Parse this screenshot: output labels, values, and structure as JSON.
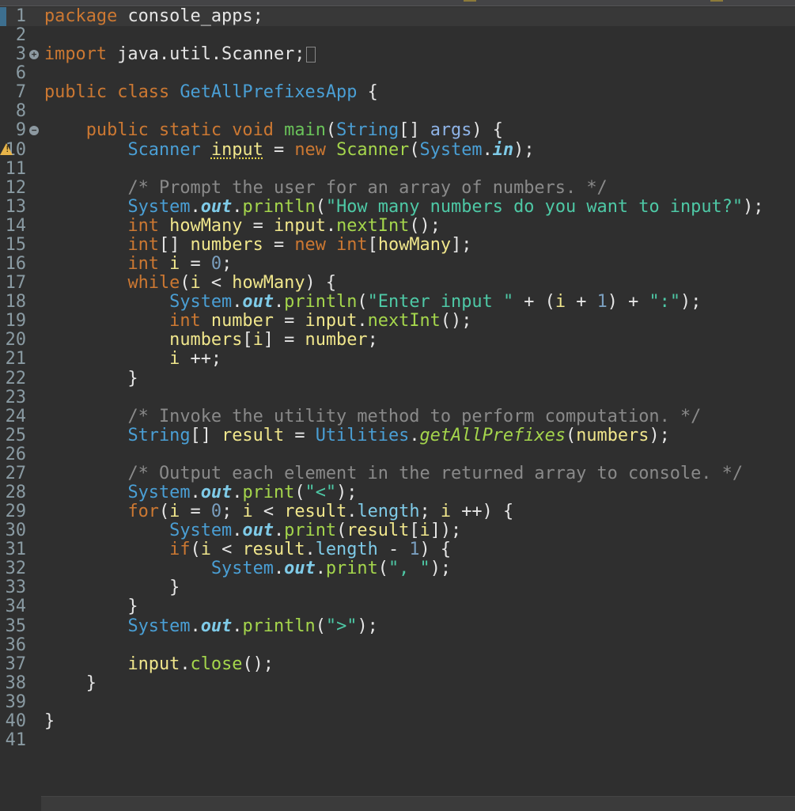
{
  "editor": {
    "language": "java",
    "current_line": 1,
    "lines": [
      {
        "n": "1",
        "tokens": [
          [
            "kw",
            "package"
          ],
          [
            "plain",
            " console_apps;"
          ]
        ]
      },
      {
        "n": "2",
        "tokens": []
      },
      {
        "n": "3",
        "fold": "expand",
        "folded": true,
        "tokens": [
          [
            "kw",
            "import"
          ],
          [
            "plain",
            " java.util.Scanner;"
          ]
        ]
      },
      {
        "n": "6",
        "tokens": []
      },
      {
        "n": "7",
        "tokens": [
          [
            "kw",
            "public"
          ],
          [
            "plain",
            " "
          ],
          [
            "kw",
            "class"
          ],
          [
            "plain",
            " "
          ],
          [
            "type",
            "GetAllPrefixesApp"
          ],
          [
            "plain",
            " {"
          ]
        ]
      },
      {
        "n": "8",
        "tokens": []
      },
      {
        "n": "9",
        "fold": "collapse",
        "tokens": [
          [
            "plain",
            "    "
          ],
          [
            "kw",
            "public"
          ],
          [
            "plain",
            " "
          ],
          [
            "kw",
            "static"
          ],
          [
            "plain",
            " "
          ],
          [
            "kw",
            "void"
          ],
          [
            "plain",
            " "
          ],
          [
            "mainm",
            "main"
          ],
          [
            "plain",
            "("
          ],
          [
            "type",
            "String"
          ],
          [
            "plain",
            "[] "
          ],
          [
            "param",
            "args"
          ],
          [
            "plain",
            ") {"
          ]
        ]
      },
      {
        "n": "10",
        "warning": true,
        "tokens": [
          [
            "plain",
            "        "
          ],
          [
            "type",
            "Scanner"
          ],
          [
            "plain",
            " "
          ],
          [
            "localw",
            "input"
          ],
          [
            "plain",
            " = "
          ],
          [
            "kw",
            "new"
          ],
          [
            "plain",
            " "
          ],
          [
            "ctor",
            "Scanner"
          ],
          [
            "plain",
            "("
          ],
          [
            "type",
            "System"
          ],
          [
            "plain",
            "."
          ],
          [
            "sfield",
            "in"
          ],
          [
            "plain",
            ");"
          ]
        ]
      },
      {
        "n": "11",
        "tokens": []
      },
      {
        "n": "12",
        "tokens": [
          [
            "plain",
            "        "
          ],
          [
            "comment",
            "/* Prompt the user for an array of numbers. */"
          ]
        ]
      },
      {
        "n": "13",
        "tokens": [
          [
            "plain",
            "        "
          ],
          [
            "type",
            "System"
          ],
          [
            "plain",
            "."
          ],
          [
            "sfield",
            "out"
          ],
          [
            "plain",
            "."
          ],
          [
            "method",
            "println"
          ],
          [
            "plain",
            "("
          ],
          [
            "str",
            "\"How many numbers do you want to input?\""
          ],
          [
            "plain",
            ");"
          ]
        ]
      },
      {
        "n": "14",
        "tokens": [
          [
            "plain",
            "        "
          ],
          [
            "kw",
            "int"
          ],
          [
            "plain",
            " "
          ],
          [
            "local",
            "howMany"
          ],
          [
            "plain",
            " = "
          ],
          [
            "local",
            "input"
          ],
          [
            "plain",
            "."
          ],
          [
            "method",
            "nextInt"
          ],
          [
            "plain",
            "();"
          ]
        ]
      },
      {
        "n": "15",
        "tokens": [
          [
            "plain",
            "        "
          ],
          [
            "kw",
            "int"
          ],
          [
            "plain",
            "[] "
          ],
          [
            "local",
            "numbers"
          ],
          [
            "plain",
            " = "
          ],
          [
            "kw",
            "new"
          ],
          [
            "plain",
            " "
          ],
          [
            "kw",
            "int"
          ],
          [
            "plain",
            "["
          ],
          [
            "local",
            "howMany"
          ],
          [
            "plain",
            "];"
          ]
        ]
      },
      {
        "n": "16",
        "tokens": [
          [
            "plain",
            "        "
          ],
          [
            "kw",
            "int"
          ],
          [
            "plain",
            " "
          ],
          [
            "local",
            "i"
          ],
          [
            "plain",
            " = "
          ],
          [
            "num",
            "0"
          ],
          [
            "plain",
            ";"
          ]
        ]
      },
      {
        "n": "17",
        "tokens": [
          [
            "plain",
            "        "
          ],
          [
            "kw",
            "while"
          ],
          [
            "plain",
            "("
          ],
          [
            "local",
            "i"
          ],
          [
            "plain",
            " < "
          ],
          [
            "local",
            "howMany"
          ],
          [
            "plain",
            ") {"
          ]
        ]
      },
      {
        "n": "18",
        "tokens": [
          [
            "plain",
            "            "
          ],
          [
            "type",
            "System"
          ],
          [
            "plain",
            "."
          ],
          [
            "sfield",
            "out"
          ],
          [
            "plain",
            "."
          ],
          [
            "method",
            "println"
          ],
          [
            "plain",
            "("
          ],
          [
            "str",
            "\"Enter input \""
          ],
          [
            "plain",
            " + ("
          ],
          [
            "local",
            "i"
          ],
          [
            "plain",
            " + "
          ],
          [
            "num",
            "1"
          ],
          [
            "plain",
            ") + "
          ],
          [
            "str",
            "\":\""
          ],
          [
            "plain",
            ");"
          ]
        ]
      },
      {
        "n": "19",
        "tokens": [
          [
            "plain",
            "            "
          ],
          [
            "kw",
            "int"
          ],
          [
            "plain",
            " "
          ],
          [
            "local",
            "number"
          ],
          [
            "plain",
            " = "
          ],
          [
            "local",
            "input"
          ],
          [
            "plain",
            "."
          ],
          [
            "method",
            "nextInt"
          ],
          [
            "plain",
            "();"
          ]
        ]
      },
      {
        "n": "20",
        "tokens": [
          [
            "plain",
            "            "
          ],
          [
            "local",
            "numbers"
          ],
          [
            "plain",
            "["
          ],
          [
            "local",
            "i"
          ],
          [
            "plain",
            "] = "
          ],
          [
            "local",
            "number"
          ],
          [
            "plain",
            ";"
          ]
        ]
      },
      {
        "n": "21",
        "tokens": [
          [
            "plain",
            "            "
          ],
          [
            "local",
            "i"
          ],
          [
            "plain",
            " ++;"
          ]
        ]
      },
      {
        "n": "22",
        "tokens": [
          [
            "plain",
            "        }"
          ]
        ]
      },
      {
        "n": "23",
        "tokens": []
      },
      {
        "n": "24",
        "tokens": [
          [
            "plain",
            "        "
          ],
          [
            "comment",
            "/* Invoke the utility method to perform computation. */"
          ]
        ]
      },
      {
        "n": "25",
        "tokens": [
          [
            "plain",
            "        "
          ],
          [
            "type",
            "String"
          ],
          [
            "plain",
            "[] "
          ],
          [
            "local",
            "result"
          ],
          [
            "plain",
            " = "
          ],
          [
            "type",
            "Utilities"
          ],
          [
            "plain",
            "."
          ],
          [
            "smethod",
            "getAllPrefixes"
          ],
          [
            "plain",
            "("
          ],
          [
            "local",
            "numbers"
          ],
          [
            "plain",
            ");"
          ]
        ]
      },
      {
        "n": "26",
        "tokens": []
      },
      {
        "n": "27",
        "tokens": [
          [
            "plain",
            "        "
          ],
          [
            "comment",
            "/* Output each element in the returned array to console. */"
          ]
        ]
      },
      {
        "n": "28",
        "tokens": [
          [
            "plain",
            "        "
          ],
          [
            "type",
            "System"
          ],
          [
            "plain",
            "."
          ],
          [
            "sfield",
            "out"
          ],
          [
            "plain",
            "."
          ],
          [
            "method",
            "print"
          ],
          [
            "plain",
            "("
          ],
          [
            "str",
            "\"<\""
          ],
          [
            "plain",
            ");"
          ]
        ]
      },
      {
        "n": "29",
        "tokens": [
          [
            "plain",
            "        "
          ],
          [
            "kw",
            "for"
          ],
          [
            "plain",
            "("
          ],
          [
            "local",
            "i"
          ],
          [
            "plain",
            " = "
          ],
          [
            "num",
            "0"
          ],
          [
            "plain",
            "; "
          ],
          [
            "local",
            "i"
          ],
          [
            "plain",
            " < "
          ],
          [
            "local",
            "result"
          ],
          [
            "plain",
            "."
          ],
          [
            "field",
            "length"
          ],
          [
            "plain",
            "; "
          ],
          [
            "local",
            "i"
          ],
          [
            "plain",
            " ++) {"
          ]
        ]
      },
      {
        "n": "30",
        "tokens": [
          [
            "plain",
            "            "
          ],
          [
            "type",
            "System"
          ],
          [
            "plain",
            "."
          ],
          [
            "sfield",
            "out"
          ],
          [
            "plain",
            "."
          ],
          [
            "method",
            "print"
          ],
          [
            "plain",
            "("
          ],
          [
            "local",
            "result"
          ],
          [
            "plain",
            "["
          ],
          [
            "local",
            "i"
          ],
          [
            "plain",
            "]);"
          ]
        ]
      },
      {
        "n": "31",
        "tokens": [
          [
            "plain",
            "            "
          ],
          [
            "kw",
            "if"
          ],
          [
            "plain",
            "("
          ],
          [
            "local",
            "i"
          ],
          [
            "plain",
            " < "
          ],
          [
            "local",
            "result"
          ],
          [
            "plain",
            "."
          ],
          [
            "field",
            "length"
          ],
          [
            "plain",
            " - "
          ],
          [
            "num",
            "1"
          ],
          [
            "plain",
            ") {"
          ]
        ]
      },
      {
        "n": "32",
        "tokens": [
          [
            "plain",
            "                "
          ],
          [
            "type",
            "System"
          ],
          [
            "plain",
            "."
          ],
          [
            "sfield",
            "out"
          ],
          [
            "plain",
            "."
          ],
          [
            "method",
            "print"
          ],
          [
            "plain",
            "("
          ],
          [
            "str",
            "\", \""
          ],
          [
            "plain",
            ");"
          ]
        ]
      },
      {
        "n": "33",
        "tokens": [
          [
            "plain",
            "            }"
          ]
        ]
      },
      {
        "n": "34",
        "tokens": [
          [
            "plain",
            "        }"
          ]
        ]
      },
      {
        "n": "35",
        "tokens": [
          [
            "plain",
            "        "
          ],
          [
            "type",
            "System"
          ],
          [
            "plain",
            "."
          ],
          [
            "sfield",
            "out"
          ],
          [
            "plain",
            "."
          ],
          [
            "method",
            "println"
          ],
          [
            "plain",
            "("
          ],
          [
            "str",
            "\">\""
          ],
          [
            "plain",
            ");"
          ]
        ]
      },
      {
        "n": "36",
        "tokens": []
      },
      {
        "n": "37",
        "tokens": [
          [
            "plain",
            "        "
          ],
          [
            "local",
            "input"
          ],
          [
            "plain",
            "."
          ],
          [
            "method",
            "close"
          ],
          [
            "plain",
            "();"
          ]
        ]
      },
      {
        "n": "38",
        "tokens": [
          [
            "plain",
            "    }"
          ]
        ]
      },
      {
        "n": "39",
        "tokens": []
      },
      {
        "n": "40",
        "tokens": [
          [
            "plain",
            "}"
          ]
        ]
      },
      {
        "n": "41",
        "tokens": []
      }
    ]
  },
  "icons": {
    "fold_expand": "+",
    "fold_collapse": "−",
    "warning": "!"
  }
}
